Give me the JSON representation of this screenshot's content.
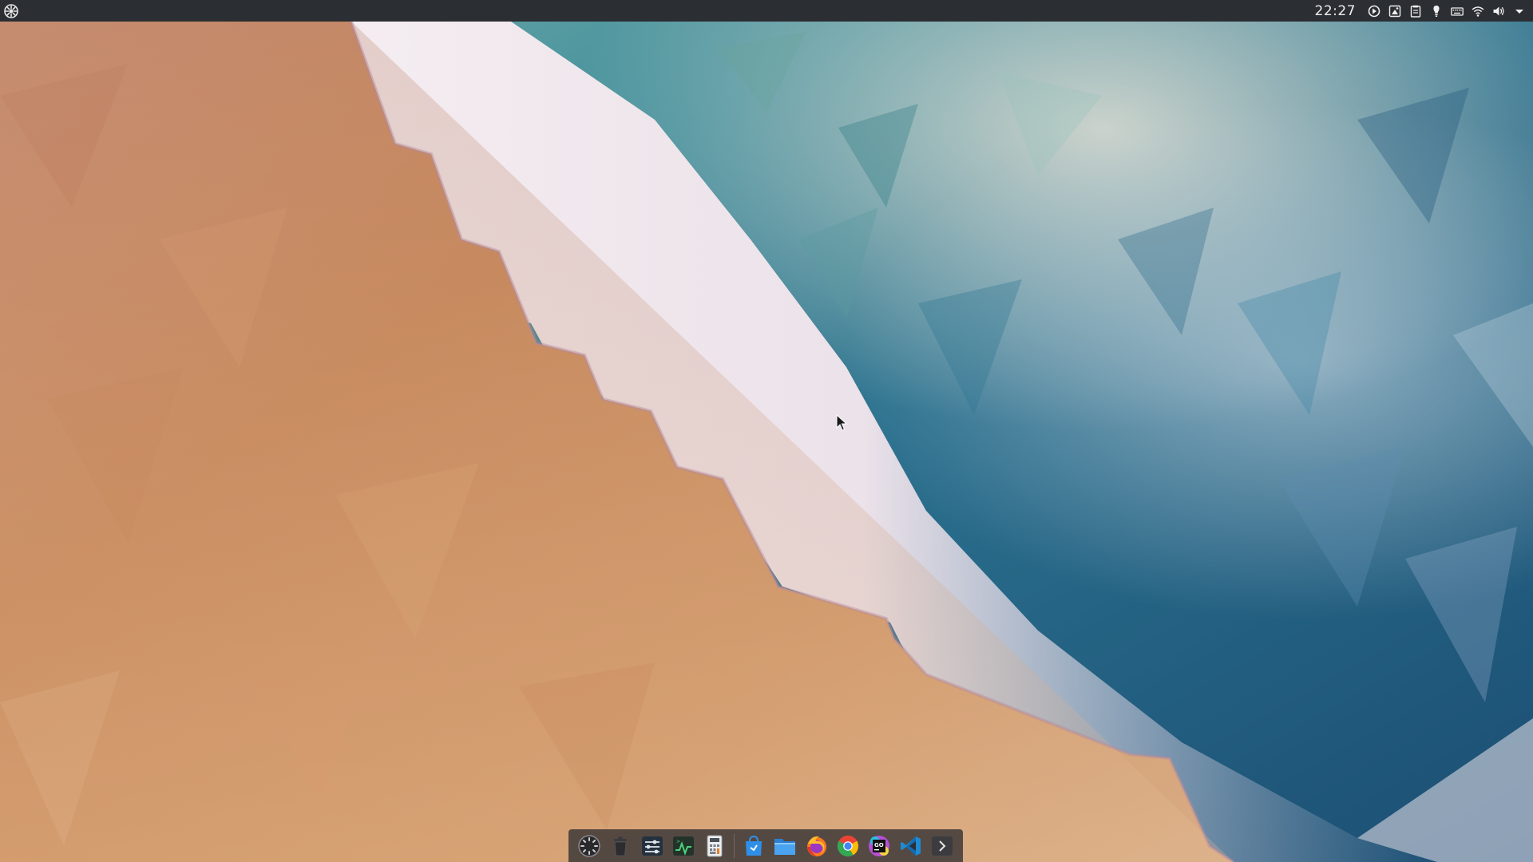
{
  "top_panel": {
    "launcher_icon": "system-menu-icon",
    "clock": "22:27",
    "tray_icons": [
      "update-notifier-icon",
      "screenshot-tool-icon",
      "clipboard-icon",
      "notification-bulb-icon",
      "keyboard-layout-icon",
      "wifi-icon",
      "volume-icon",
      "tray-expand-arrow-icon"
    ]
  },
  "dock": {
    "items": [
      "multitasking-view-icon",
      "trash-icon",
      "settings-control-center-icon",
      "system-monitor-icon",
      "calculator-icon",
      "app-store-icon",
      "file-manager-icon",
      "firefox-icon",
      "chrome-icon",
      "goland-icon",
      "vscode-icon",
      "terminal-icon"
    ]
  },
  "colors": {
    "panel_bg": "#2b2e33",
    "dock_bg": "#373436",
    "sand": "#c98a5a",
    "foam": "#f1e6ec",
    "ocean": "#2e7c94",
    "deep_ocean": "#1c4e74"
  }
}
